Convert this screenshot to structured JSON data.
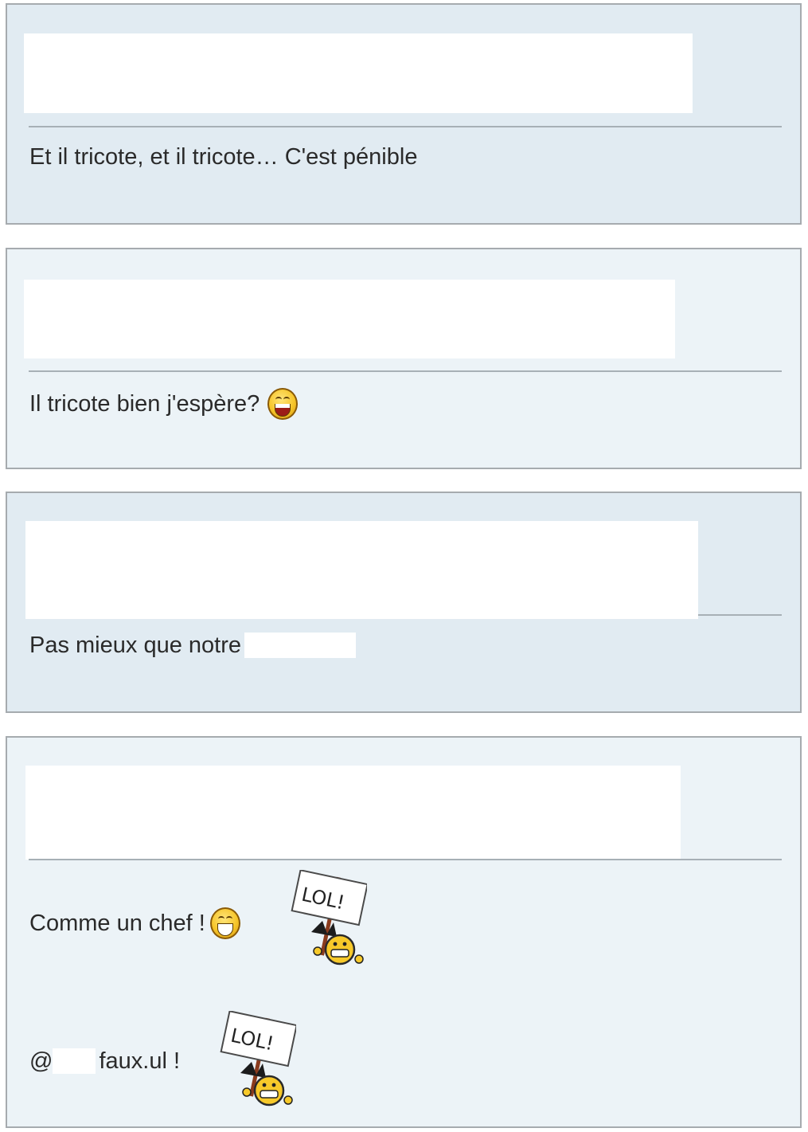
{
  "posts": [
    {
      "text": "Et il tricote, et il tricote… C'est pénible"
    },
    {
      "text": "Il tricote bien j'espère?",
      "emoji": "laughing-smiley"
    },
    {
      "text": "Pas mieux que notre"
    },
    {
      "line1": "Comme un chef !",
      "line1_emoji": "grin-smiley",
      "lol_sign": "LOL!",
      "line2_prefix": "@",
      "line2_suffix": "faux.ul !"
    }
  ]
}
